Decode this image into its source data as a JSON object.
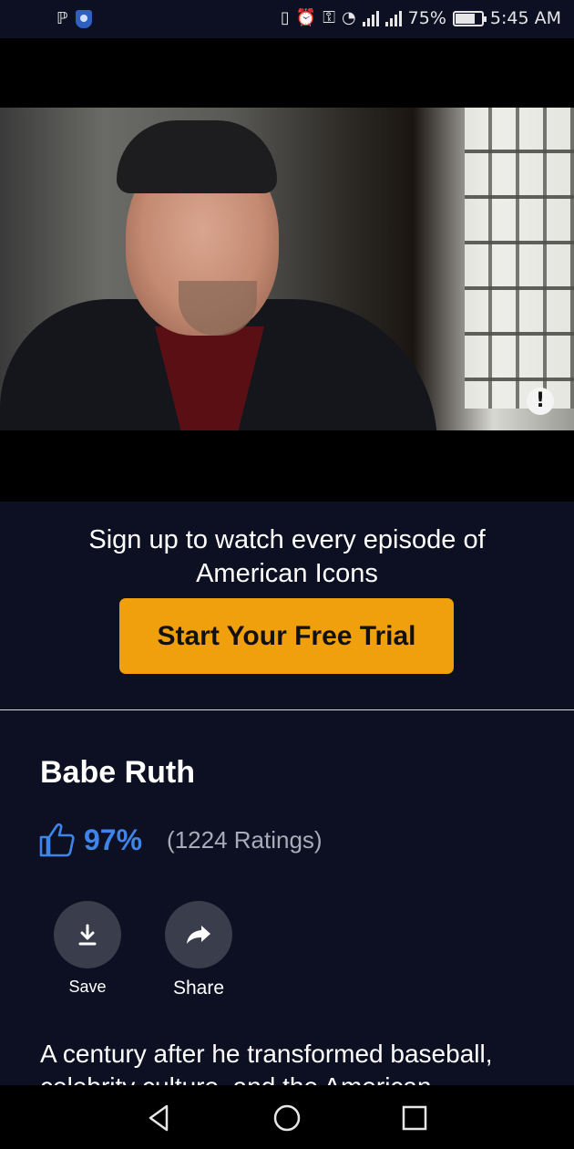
{
  "status_bar": {
    "battery_percent": "75%",
    "time": "5:45 AM"
  },
  "video": {
    "warning_icon": "exclamation-icon"
  },
  "signup": {
    "text": "Sign up to watch every episode of American Icons",
    "button_label": "Start Your Free Trial"
  },
  "episode": {
    "title": "Babe Ruth",
    "rating_percent": "97%",
    "ratings_count": "(1224 Ratings)",
    "description": "A century after he transformed baseball, celebrity culture, and the American"
  },
  "actions": {
    "save_label": "Save",
    "share_label": "Share"
  },
  "colors": {
    "background": "#0c1022",
    "accent": "#f0a00c",
    "rating_blue": "#3f84e8"
  }
}
